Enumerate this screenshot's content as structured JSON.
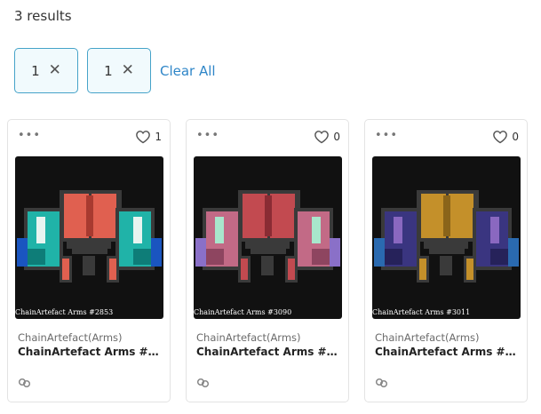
{
  "results_label": "3 results",
  "filters": [
    {
      "value": "1",
      "remove_icon": "close-icon"
    },
    {
      "value": "1",
      "remove_icon": "close-icon"
    }
  ],
  "clear_all_label": "Clear All",
  "cards": [
    {
      "likes": "1",
      "collection": "ChainArtefact(Arms)",
      "name": "ChainArtefact Arms #2853",
      "caption": "ChainArtefact Arms #2853",
      "colors": {
        "body": "#e06050",
        "dark": "#a83a30",
        "arm": "#20b3a8",
        "armDark": "#0e7d78",
        "hi": "#e8f4f0",
        "hand": "#1a55c0"
      }
    },
    {
      "likes": "0",
      "collection": "ChainArtefact(Arms)",
      "name": "ChainArtefact Arms #3090",
      "caption": "ChainArtefact Arms #3090",
      "colors": {
        "body": "#c24a50",
        "dark": "#8a2c34",
        "arm": "#c26a86",
        "armDark": "#8e4560",
        "hi": "#a8e6cc",
        "hand": "#8a70c8"
      }
    },
    {
      "likes": "0",
      "collection": "ChainArtefact(Arms)",
      "name": "ChainArtefact Arms #3011",
      "caption": "ChainArtefact Arms #3011",
      "colors": {
        "body": "#c4902a",
        "dark": "#8a641a",
        "arm": "#3a3580",
        "armDark": "#26225a",
        "hi": "#8a68c0",
        "hand": "#2a6ab0"
      }
    }
  ]
}
